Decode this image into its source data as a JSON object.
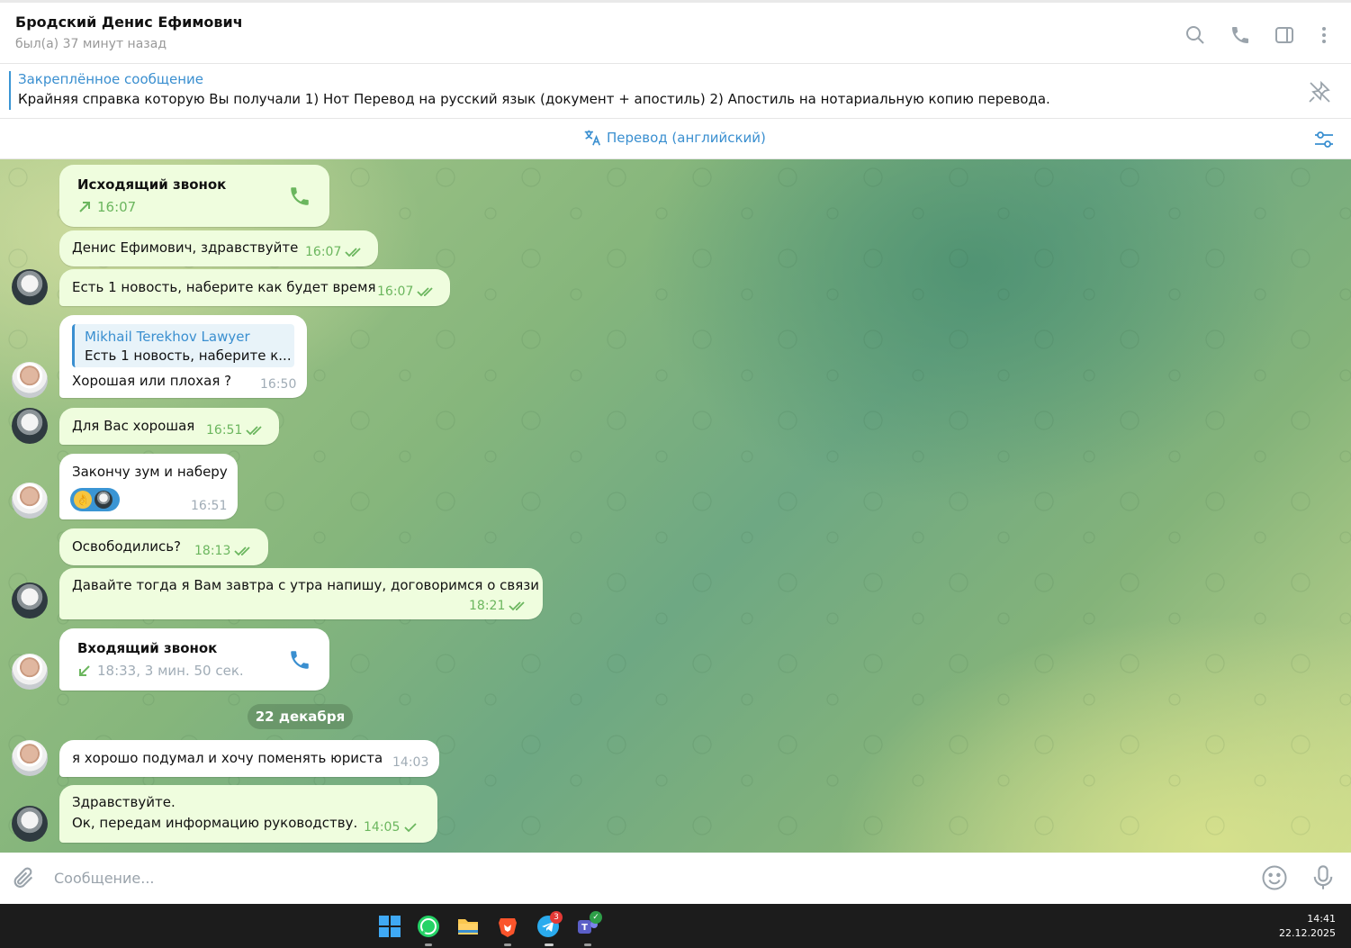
{
  "header": {
    "title": "Бродский Денис Ефимович",
    "status": "был(а) 37 минут назад",
    "icons": [
      "search-icon",
      "phone-icon",
      "sidebar-toggle-icon",
      "more-vertical-icon"
    ]
  },
  "pinned": {
    "title": "Закреплённое сообщение",
    "text": "Крайняя справка которую Вы получали  1) Нот Перевод на русский язык (документ + апостиль) 2) Апостиль на нотариальную копию перевода."
  },
  "translate": {
    "label": "Перевод (английский)"
  },
  "messages": [
    {
      "type": "call",
      "direction": "out",
      "title": "Исходящий звонок",
      "time": "16:07"
    },
    {
      "type": "text",
      "direction": "out",
      "text": "Денис Ефимович, здравствуйте",
      "time": "16:07",
      "read": true
    },
    {
      "type": "text",
      "direction": "out",
      "text": "Есть 1 новость, наберите как будет время",
      "time": "16:07",
      "read": true
    },
    {
      "type": "reply",
      "direction": "in",
      "reply_name": "Mikhail Terekhov Lawyer",
      "reply_text": "Есть 1 новость, наберите к...",
      "text": "Хорошая или плохая ?",
      "time": "16:50"
    },
    {
      "type": "text",
      "direction": "out",
      "text": "Для Вас хорошая",
      "time": "16:51",
      "read": true
    },
    {
      "type": "text",
      "direction": "in",
      "text": "Закончу зум и наберу",
      "time": "16:51",
      "reaction": "👌"
    },
    {
      "type": "text",
      "direction": "out",
      "text": "Освободились?",
      "time": "18:13",
      "read": true
    },
    {
      "type": "text",
      "direction": "out",
      "text": "Давайте тогда я Вам завтра с утра напишу, договоримся о связи",
      "time": "18:21",
      "read": true
    },
    {
      "type": "call",
      "direction": "in",
      "title": "Входящий звонок",
      "time": "18:33, 3 мин. 50 сек."
    },
    {
      "type": "text",
      "direction": "in",
      "text": "я хорошо подумал и хочу поменять юриста",
      "time": "14:03"
    },
    {
      "type": "text",
      "direction": "out",
      "text_line1": "Здравствуйте.",
      "text_line2": "Ок, передам информацию руководству.",
      "time": "14:05",
      "read": false
    }
  ],
  "date_separator": "22 декабря",
  "composer": {
    "placeholder": "Сообщение..."
  },
  "taskbar": {
    "time": "14:41",
    "date": "22.12.2025",
    "telegram_badge": "3",
    "apps": [
      "windows-start-icon",
      "whatsapp-icon",
      "file-explorer-icon",
      "brave-browser-icon",
      "telegram-icon",
      "teams-icon"
    ]
  },
  "colors": {
    "accent": "#3a8fd0",
    "out_bubble": "#effdde",
    "in_bubble": "#ffffff",
    "read_check": "#6bb65e",
    "taskbar": "#1c1c1c"
  }
}
